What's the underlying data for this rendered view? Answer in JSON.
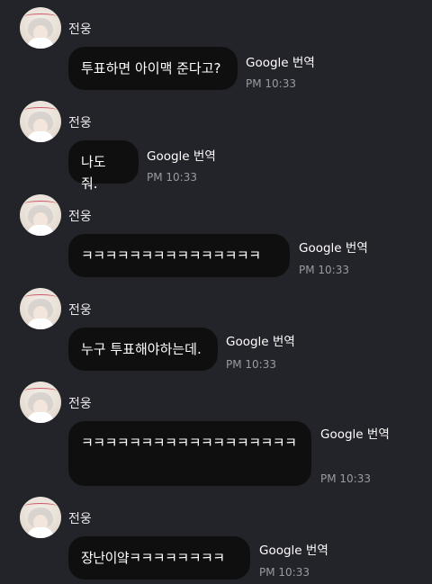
{
  "messages": [
    {
      "sender": "전웅",
      "text": "투표하면 아이맥 준다고?",
      "translate_label": "Google 번역",
      "time": "PM 10:33"
    },
    {
      "sender": "전웅",
      "text": "나도 줘.",
      "translate_label": "Google 번역",
      "time": "PM 10:33"
    },
    {
      "sender": "전웅",
      "text": "ㅋㅋㅋㅋㅋㅋㅋㅋㅋㅋㅋㅋㅋㅋㅋ",
      "translate_label": "Google 번역",
      "time": "PM 10:33"
    },
    {
      "sender": "전웅",
      "text": "누구 투표해야하는데.",
      "translate_label": "Google 번역",
      "time": "PM 10:33"
    },
    {
      "sender": "전웅",
      "text": "ㅋㅋㅋㅋㅋㅋㅋㅋㅋㅋㅋㅋㅋㅋㅋㅋㅋㅋ",
      "translate_label": "Google 번역",
      "time": "PM 10:33"
    },
    {
      "sender": "전웅",
      "text": "장난이얔ㅋㅋㅋㅋㅋㅋㅋㅋ",
      "translate_label": "Google 번역",
      "time": "PM 10:33"
    }
  ]
}
